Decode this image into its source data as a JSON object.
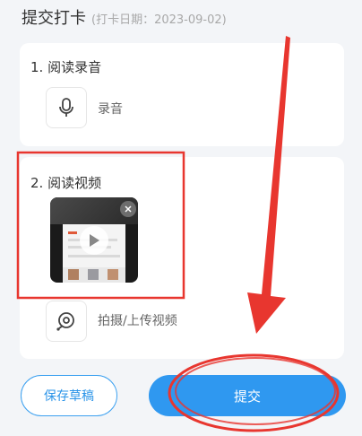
{
  "header": {
    "title": "提交打卡",
    "date_note": "(打卡日期：2023-09-02)"
  },
  "sections": [
    {
      "title": "1. 阅读录音",
      "action_label": "录音",
      "action_icon": "microphone-icon"
    },
    {
      "title": "2. 阅读视频",
      "action_label": "拍摄/上传视频",
      "action_icon": "video-camera-icon",
      "video": {
        "has_play": true,
        "has_remove": true
      }
    }
  ],
  "buttons": {
    "draft": "保存草稿",
    "submit": "提交"
  },
  "colors": {
    "accent": "#2f98f0",
    "annotation": "#e8362f",
    "background": "#f3f5f8"
  }
}
